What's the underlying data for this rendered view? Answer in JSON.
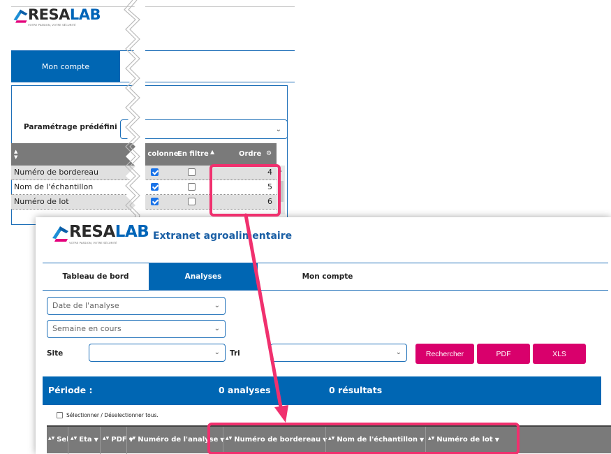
{
  "top": {
    "logo": {
      "word_a": "RESA",
      "word_b": "LAB",
      "tagline": "VOTRE PASSION, VOTRE SÉCURITÉ"
    },
    "tab_account": "Mon compte",
    "preset_label": "Paramétrage prédéfini",
    "columns": {
      "in_column": "En colonne",
      "in_filter": "En filtre",
      "order": "Ordre"
    },
    "rows": [
      {
        "label": "Numéro de bordereau",
        "in_column": true,
        "in_filter": false,
        "order": "4"
      },
      {
        "label": "Nom de l'échantillon",
        "in_column": true,
        "in_filter": false,
        "order": "5"
      },
      {
        "label": "Numéro de lot",
        "in_column": true,
        "in_filter": false,
        "order": "6"
      }
    ]
  },
  "front": {
    "logo": {
      "word_a": "RESA",
      "word_b": "LAB",
      "tagline": "VOTRE PASSION, VOTRE SÉCURITÉ"
    },
    "app_title": "Extranet agroalimentaire",
    "tabs": [
      {
        "label": "Tableau de bord",
        "active": false
      },
      {
        "label": "Analyses",
        "active": true
      },
      {
        "label": "Mon compte",
        "active": false
      }
    ],
    "filters": {
      "date_value": "Date de l'analyse",
      "period_value": "Semaine en cours",
      "site_label": "Site",
      "site_value": "",
      "sort_label": "Tri",
      "sort_value": ""
    },
    "buttons": {
      "search": "Rechercher",
      "pdf": "PDF",
      "xls": "XLS"
    },
    "period": {
      "label": "Période :",
      "analyses": "0 analyses",
      "results": "0 résultats"
    },
    "select_all": "Sélectionner / Déselectionner tous.",
    "table_headers": [
      "Sel",
      "Eta",
      "PDF",
      "Numéro de l'analyse",
      "Numéro de bordereau",
      "Nom de l'échantillon",
      "Numéro de lot"
    ]
  },
  "colors": {
    "primary_blue": "#0066b3",
    "accent_pink": "#d9006c",
    "highlight": "#f0306e",
    "header_gray": "#7a7a7a"
  },
  "icons": {
    "select_chevron": "chevron-down-icon",
    "sort": "sort-arrows-icon",
    "filter": "filter-triangle-icon",
    "settings": "gear-icon"
  }
}
